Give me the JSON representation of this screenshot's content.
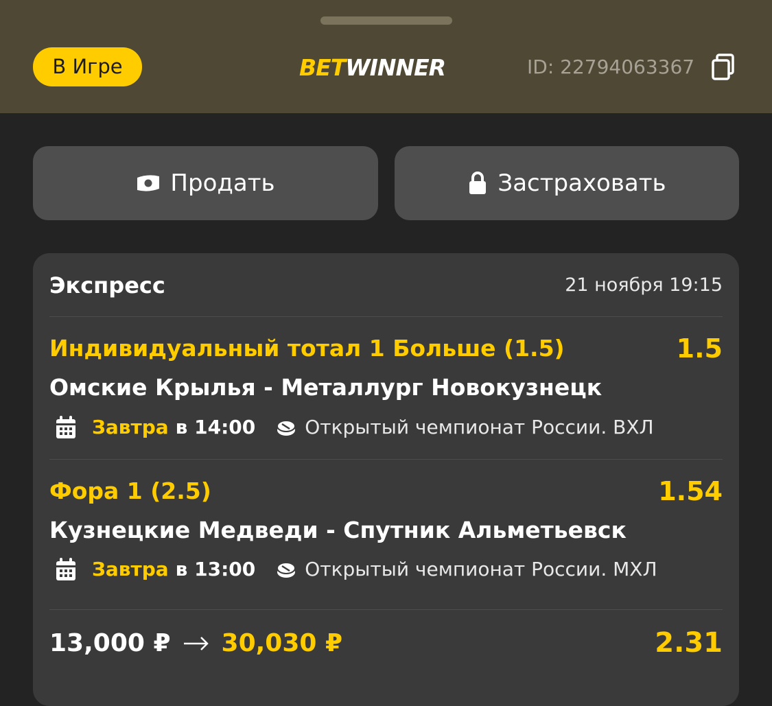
{
  "header": {
    "status": "В Игре",
    "logo": {
      "bet": "BET",
      "winner": "WINNER"
    },
    "account_id": "ID: 22794063367"
  },
  "actions": {
    "sell_label": "Продать",
    "insure_label": "Застраховать"
  },
  "bet": {
    "type": "Экспресс",
    "date": "21 ноября 19:15",
    "events": [
      {
        "outcome": "Индивидуальный тотал 1 Больше (1.5)",
        "odd": "1.5",
        "match": "Омские Крылья - Металлург Новокузнецк",
        "day": "Завтра",
        "time": "в 14:00",
        "league": "Открытый чемпионат России. ВХЛ"
      },
      {
        "outcome": "Фора 1 (2.5)",
        "odd": "1.54",
        "match": "Кузнецкие Медведи - Спутник Альметьевск",
        "day": "Завтра",
        "time": "в 13:00",
        "league": "Открытый чемпионат России. МХЛ"
      }
    ],
    "stake": "13,000 ₽",
    "payout": "30,030 ₽",
    "total_odd": "2.31"
  },
  "colors": {
    "accent": "#ffcc00",
    "header_bg": "#4f4834",
    "page_bg": "#232323",
    "card_bg": "#3a3a3a",
    "button_bg": "#4e4e4e"
  },
  "icons": [
    "copy-icon",
    "banknote-icon",
    "lock-icon",
    "calendar-icon",
    "hockey-puck-icon",
    "arrow-right-icon"
  ]
}
